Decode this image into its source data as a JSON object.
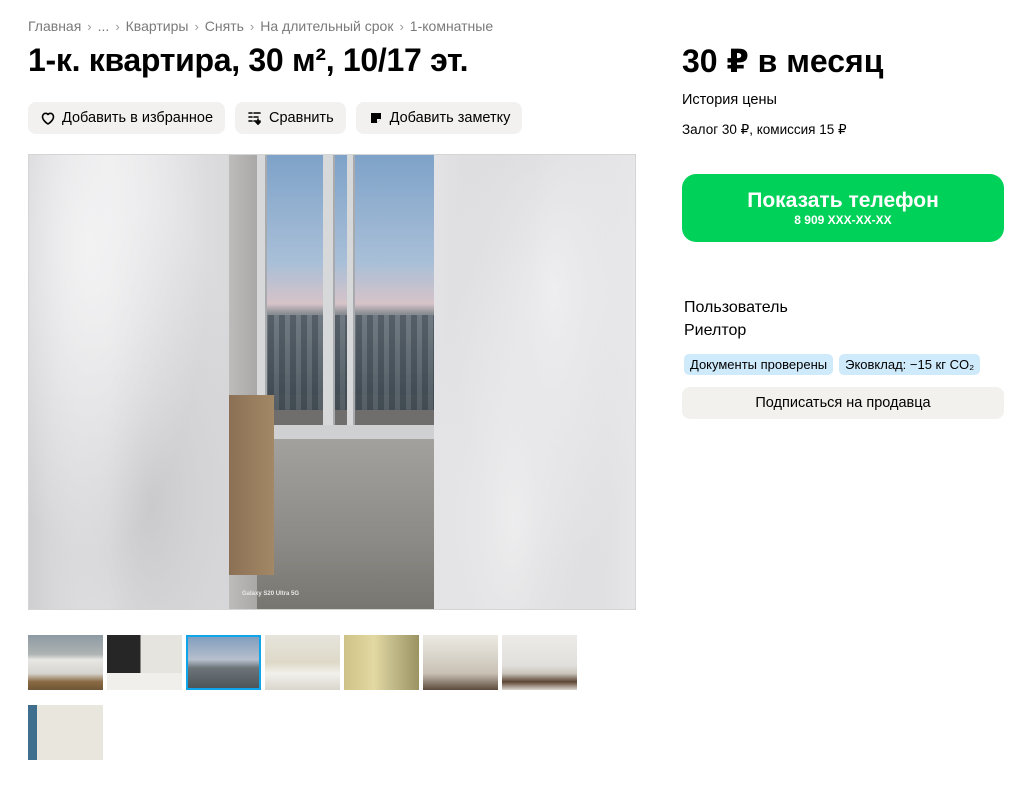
{
  "breadcrumbs": [
    "Главная",
    "...",
    "Квартиры",
    "Снять",
    "На длительный срок",
    "1-комнатные"
  ],
  "breadcrumb_separator": "›",
  "title": "1-к. квартира, 30 м², 10/17 эт.",
  "actions": {
    "favorite": {
      "label": "Добавить в избранное",
      "icon": "heart-icon"
    },
    "compare": {
      "label": "Сравнить",
      "icon": "compare-icon"
    },
    "note": {
      "label": "Добавить заметку",
      "icon": "note-icon"
    }
  },
  "photo": {
    "watermark": "Galaxy S20 Ultra 5G"
  },
  "thumbnails": {
    "count": 8,
    "active_index": 3
  },
  "pricing": {
    "price": "30 ₽ в месяц",
    "history_link": "История цены",
    "deposit": "Залог 30 ₽, комиссия 15 ₽"
  },
  "phone": {
    "label": "Показать телефон",
    "masked_number": "8 909 XXX-XX-XX"
  },
  "seller": {
    "name": "Пользователь",
    "type": "Риелтор",
    "badges": [
      "Документы проверены",
      "Эковклад: −15 кг CO₂"
    ],
    "subscribe_label": "Подписаться на продавца"
  },
  "colors": {
    "phone_button": "#00d159",
    "badge": "#cfeafb",
    "action_button": "#f2f1f0",
    "active_thumb_outline": "#0ea5e9"
  }
}
